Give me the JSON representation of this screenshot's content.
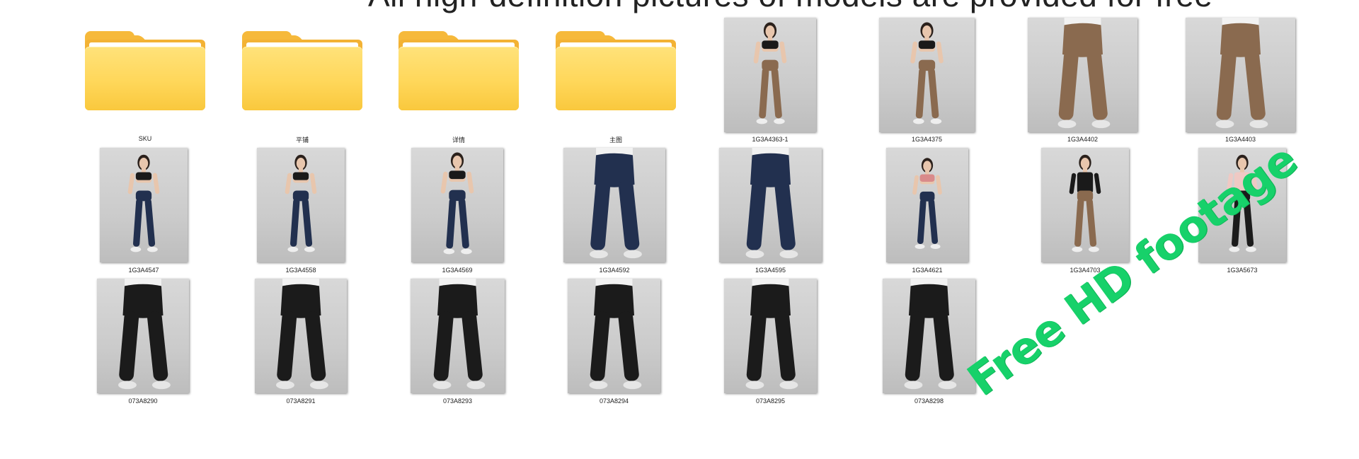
{
  "headline": "All high-definition pictures of models are provided for free",
  "watermark": "Free HD footage",
  "colors": {
    "folder": "#ffd75a",
    "watermark": "#17d16a",
    "legging_brown": "#8a6a4f",
    "legging_navy": "#22304f",
    "legging_black": "#1b1b1b"
  },
  "folders": [
    {
      "label": "SKU",
      "icon": "folder-icon"
    },
    {
      "label": "平铺",
      "icon": "folder-icon"
    },
    {
      "label": "详情",
      "icon": "folder-icon"
    },
    {
      "label": "主图",
      "icon": "folder-icon"
    }
  ],
  "photos": [
    {
      "label": "1G3A4363-1",
      "legging": "brown",
      "top": "black",
      "view": "full"
    },
    {
      "label": "1G3A4375",
      "legging": "brown",
      "top": "black",
      "view": "full"
    },
    {
      "label": "1G3A4402",
      "legging": "brown",
      "top": "none",
      "view": "legs"
    },
    {
      "label": "1G3A4403",
      "legging": "brown",
      "top": "none",
      "view": "legs"
    },
    {
      "label": "1G3A4547",
      "legging": "navy",
      "top": "black",
      "view": "full"
    },
    {
      "label": "1G3A4558",
      "legging": "navy",
      "top": "black",
      "view": "full"
    },
    {
      "label": "1G3A4569",
      "legging": "navy",
      "top": "black",
      "view": "full"
    },
    {
      "label": "1G3A4592",
      "legging": "navy",
      "top": "none",
      "view": "legs"
    },
    {
      "label": "1G3A4595",
      "legging": "navy",
      "top": "none",
      "view": "legs"
    },
    {
      "label": "1G3A4621",
      "legging": "navy",
      "top": "pink",
      "view": "full"
    },
    {
      "label": "1G3A4703",
      "legging": "brown",
      "top": "black-jacket",
      "view": "full"
    },
    {
      "label": "1G3A5673",
      "legging": "black",
      "top": "pink-jacket",
      "view": "full"
    },
    {
      "label": "073A8290",
      "legging": "black",
      "top": "none",
      "view": "legs"
    },
    {
      "label": "073A8291",
      "legging": "black",
      "top": "none",
      "view": "legs"
    },
    {
      "label": "073A8293",
      "legging": "black",
      "top": "none",
      "view": "legs"
    },
    {
      "label": "073A8294",
      "legging": "black",
      "top": "none",
      "view": "legs"
    },
    {
      "label": "073A8295",
      "legging": "black",
      "top": "none",
      "view": "legs"
    },
    {
      "label": "073A8298",
      "legging": "black",
      "top": "none",
      "view": "legs"
    }
  ]
}
